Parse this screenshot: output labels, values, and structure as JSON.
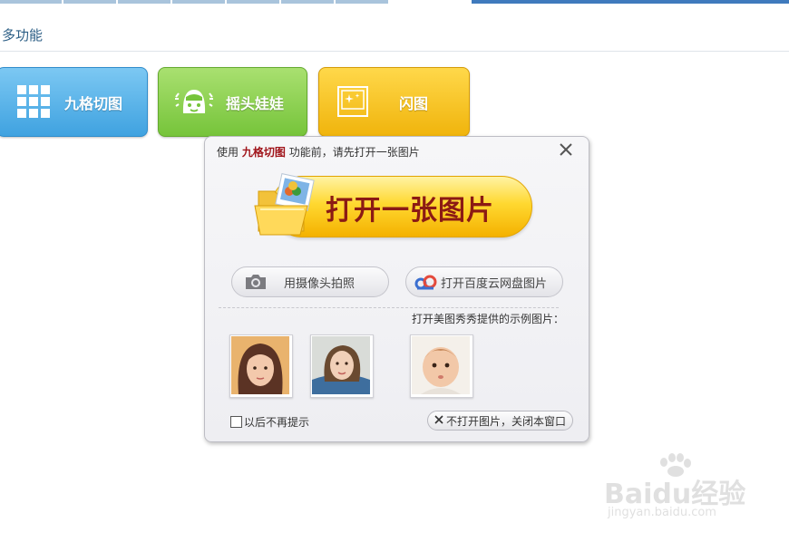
{
  "section": {
    "title": "多功能"
  },
  "features": [
    {
      "label": "九格切图",
      "icon": "grid-icon",
      "color": "#3fa2e0"
    },
    {
      "label": "摇头娃娃",
      "icon": "doll-face-icon",
      "color": "#76c43a"
    },
    {
      "label": "闪图",
      "icon": "sparkle-photo-icon",
      "color": "#f0b40c"
    }
  ],
  "dialog": {
    "prefix": "使用",
    "feature_name": "九格切图",
    "suffix": "功能前，请先打开一张图片",
    "open_button": "打开一张图片",
    "camera_button": "用摄像头拍照",
    "cloud_button": "打开百度云网盘图片",
    "sample_caption": "打开美图秀秀提供的示例图片：",
    "checkbox_label": "以后不再提示",
    "close_button": "不打开图片，关闭本窗口",
    "close_icon": "close-icon"
  },
  "watermark": {
    "brand": "Baidu经验",
    "url": "jingyan.baidu.com"
  },
  "colors": {
    "accent_blue": "#3f7abd",
    "title_red": "#8b1a14"
  }
}
